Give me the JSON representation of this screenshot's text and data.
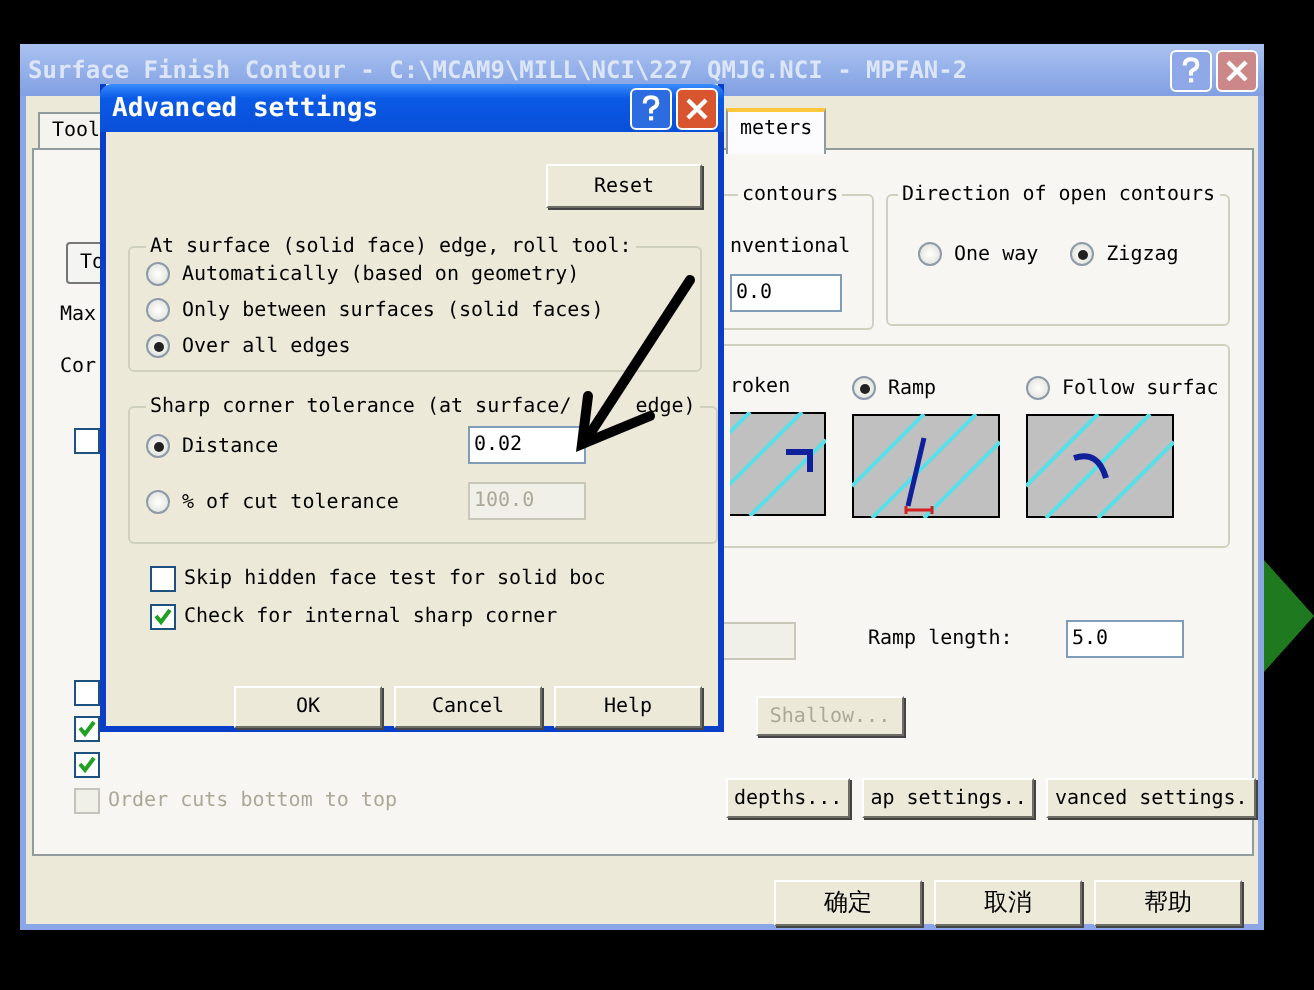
{
  "main_window": {
    "title": "Surface Finish Contour - C:\\MCAM9\\MILL\\NCI\\227 QMJG.NCI - MPFAN-2"
  },
  "tabs": [
    {
      "label": "Tool",
      "selected": false
    },
    {
      "label": "meters",
      "selected": true
    }
  ],
  "left_fragments": {
    "button": "To",
    "labels": [
      "Max",
      "Cor"
    ]
  },
  "upper_checkbox": {
    "checked": false
  },
  "lower_checkboxes": [
    {
      "checked": false
    },
    {
      "checked": true
    },
    {
      "checked": true
    },
    {
      "checked": false,
      "label": "Order cuts bottom to top",
      "disabled": true
    }
  ],
  "contours_group": {
    "legend": "contours",
    "option": "nventional",
    "value": "0.0"
  },
  "direction_group": {
    "legend": "Direction of open contours",
    "options": [
      {
        "label": "One way",
        "selected": false
      },
      {
        "label": "Zigzag",
        "selected": true
      }
    ]
  },
  "entry_group": {
    "options": [
      {
        "label": "roken",
        "kind": "broken"
      },
      {
        "label": "Ramp",
        "kind": "ramp",
        "selected": true
      },
      {
        "label": "Follow surfac",
        "kind": "follow",
        "selected": false
      }
    ]
  },
  "ramp_length": {
    "label": "Ramp length:",
    "value": "5.0"
  },
  "shallow_button": {
    "label": "Shallow...",
    "disabled": true
  },
  "settings_buttons": [
    "depths...",
    "ap settings..",
    "vanced settings."
  ],
  "footer_buttons": [
    "确定",
    "取消",
    "帮助"
  ],
  "dialog": {
    "title": "Advanced settings",
    "reset": "Reset",
    "roll_group": {
      "legend": "At surface (solid face) edge, roll tool:",
      "options": [
        {
          "label": "Automatically (based on geometry)",
          "selected": false
        },
        {
          "label": "Only between surfaces (solid faces)",
          "selected": false
        },
        {
          "label": "Over all edges",
          "selected": true
        }
      ]
    },
    "sharp_group": {
      "legend": [
        "Sharp corner tolerance (at surface/",
        "edge)"
      ],
      "options": [
        {
          "label": "Distance",
          "selected": true,
          "value": "0.02",
          "disabled": false
        },
        {
          "label": "% of cut tolerance",
          "selected": false,
          "value": "100.0",
          "disabled": true
        }
      ]
    },
    "checks": [
      {
        "label": "Skip hidden face test for solid boc",
        "checked": false
      },
      {
        "label": "Check for internal sharp corner",
        "checked": true
      }
    ],
    "buttons": [
      "OK",
      "Cancel",
      "Help"
    ]
  }
}
